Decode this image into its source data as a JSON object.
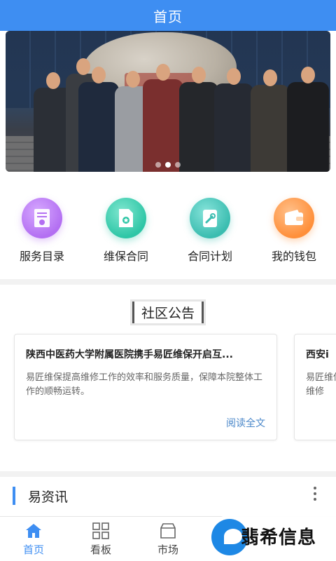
{
  "header": {
    "title": "首页"
  },
  "banner": {
    "slide_count": 3,
    "active_slide": 2
  },
  "quick_actions": [
    {
      "label": "服务目录",
      "icon": "certificate-icon",
      "color": "#b36ff2"
    },
    {
      "label": "维保合同",
      "icon": "contract-document-icon",
      "color": "#2ec6a6"
    },
    {
      "label": "合同计划",
      "icon": "wrench-clipboard-icon",
      "color": "#3bbdb0"
    },
    {
      "label": "我的钱包",
      "icon": "wallet-icon",
      "color": "#ff8f3a"
    }
  ],
  "notice": {
    "title": "社区公告",
    "cards": [
      {
        "title": "陕西中医药大学附属医院携手易匠维保开启互...",
        "body": "易匠维保提高维修工作的效率和服务质量，保障本院整体工作的顺畅运转。",
        "link": "阅读全文"
      },
      {
        "title": "西安i",
        "body": "易匠维保有维修"
      }
    ]
  },
  "news": {
    "title": "易资讯"
  },
  "tabbar": {
    "items": [
      {
        "label": "首页",
        "icon": "home-icon",
        "active": true
      },
      {
        "label": "看板",
        "icon": "grid-icon",
        "active": false
      },
      {
        "label": "市场",
        "icon": "market-box-icon",
        "active": false
      },
      {
        "label": "",
        "icon": "tab-icon-4",
        "active": false
      },
      {
        "label": "",
        "icon": "tab-icon-5",
        "active": false
      }
    ]
  },
  "watermark": {
    "text": "翡希信息"
  },
  "colors": {
    "primary": "#3e8ef2",
    "link": "#4a87c9"
  }
}
